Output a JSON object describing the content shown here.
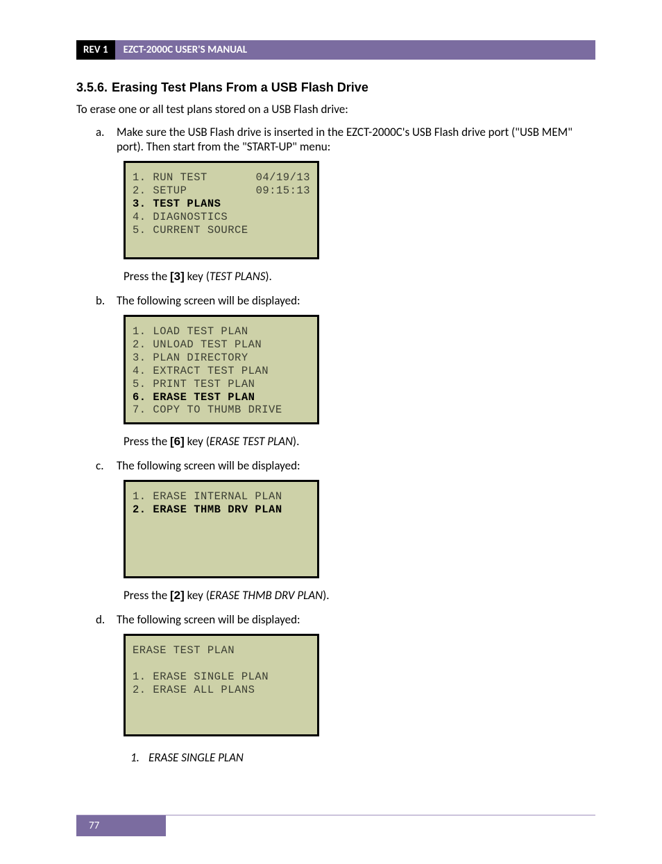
{
  "header": {
    "rev": "REV 1",
    "title": "EZCT-2000C USER'S MANUAL"
  },
  "section": {
    "number": "3.5.6.",
    "title": "Erasing Test Plans From a USB Flash Drive",
    "intro": "To erase one or all test plans stored on a USB Flash drive:"
  },
  "step_a": {
    "letter": "a.",
    "text": "Make sure the USB Flash drive is inserted in the EZCT-2000C's USB Flash drive port (\"USB MEM\" port). Then start from the \"START-UP\" menu:",
    "lcd": {
      "l1_left": "1. RUN TEST",
      "l1_right": "04/19/13",
      "l2_left": "2. SETUP",
      "l2_right": "09:15:13",
      "l3": "3. TEST PLANS",
      "l4": "4. DIAGNOSTICS",
      "l5": "5. CURRENT SOURCE"
    },
    "press_pre": "Press the ",
    "press_key": "[3]",
    "press_mid": " key (",
    "press_italic": "TEST PLANS",
    "press_end": ")."
  },
  "step_b": {
    "letter": "b.",
    "text": "The following screen will be displayed:",
    "lcd": {
      "l1": "1. LOAD TEST PLAN",
      "l2": "2. UNLOAD TEST PLAN",
      "l3": "3. PLAN DIRECTORY",
      "l4": "4. EXTRACT TEST PLAN",
      "l5": "5. PRINT TEST PLAN",
      "l6": "6. ERASE TEST PLAN",
      "l7": "7. COPY TO THUMB DRIVE"
    },
    "press_pre": "Press the ",
    "press_key": "[6]",
    "press_mid": " key (",
    "press_italic": "ERASE TEST PLAN",
    "press_end": ")."
  },
  "step_c": {
    "letter": "c.",
    "text": "The following screen will be displayed:",
    "lcd": {
      "l1": "1. ERASE INTERNAL PLAN",
      "l2": "2. ERASE THMB DRV PLAN"
    },
    "press_pre": "Press the ",
    "press_key": "[2]",
    "press_mid": " key (",
    "press_italic": "ERASE THMB DRV PLAN",
    "press_end": ")."
  },
  "step_d": {
    "letter": "d.",
    "text": "The following screen will be displayed:",
    "lcd": {
      "l0": "ERASE TEST PLAN",
      "l1": "1. ERASE SINGLE PLAN",
      "l2": "2. ERASE ALL PLANS"
    }
  },
  "sub1": {
    "num": "1.",
    "text": "ERASE SINGLE PLAN"
  },
  "footer": {
    "page": "77"
  }
}
